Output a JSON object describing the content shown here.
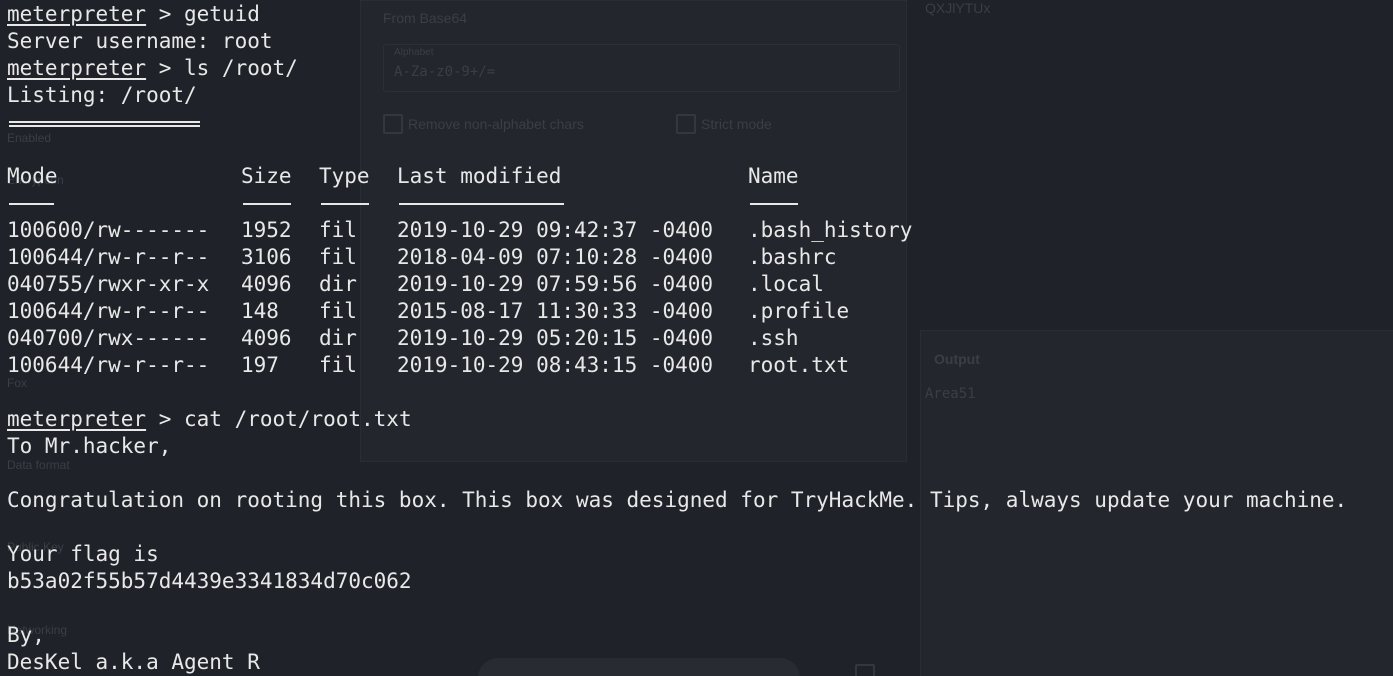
{
  "ghost": {
    "from_base64": "From Base64",
    "alphabet_label": "Alphabet",
    "alphabet_value": "A-Za-z0-9+/=",
    "remove_nonalpha": "Remove non-alphabet chars",
    "strict_mode": "Strict mode",
    "output_label": "Output",
    "output_value": "Area51",
    "top_right": "QXJlYTUx",
    "side1": "Enabled",
    "side2": "Encryption",
    "side3": "Data format",
    "side4": "Public Key",
    "side5": "Networking",
    "side6": "Fox"
  },
  "terminal": {
    "prompt": "meterpreter",
    "cmd1": " > getuid",
    "out1": "Server username: root",
    "cmd2": " > ls /root/",
    "out2": "Listing: /root/",
    "headers": {
      "mode": "Mode",
      "size": "Size",
      "type": "Type",
      "modified": "Last modified",
      "name": "Name"
    },
    "rows": [
      {
        "mode": "100600/rw-------",
        "size": "1952",
        "type": "fil",
        "modified": "2019-10-29 09:42:37 -0400",
        "name": ".bash_history"
      },
      {
        "mode": "100644/rw-r--r--",
        "size": "3106",
        "type": "fil",
        "modified": "2018-04-09 07:10:28 -0400",
        "name": ".bashrc"
      },
      {
        "mode": "040755/rwxr-xr-x",
        "size": "4096",
        "type": "dir",
        "modified": "2019-10-29 07:59:56 -0400",
        "name": ".local"
      },
      {
        "mode": "100644/rw-r--r--",
        "size": "148",
        "type": "fil",
        "modified": "2015-08-17 11:30:33 -0400",
        "name": ".profile"
      },
      {
        "mode": "040700/rwx------",
        "size": "4096",
        "type": "dir",
        "modified": "2019-10-29 05:20:15 -0400",
        "name": ".ssh"
      },
      {
        "mode": "100644/rw-r--r--",
        "size": "197",
        "type": "fil",
        "modified": "2019-10-29 08:43:15 -0400",
        "name": "root.txt"
      }
    ],
    "cmd3": " > cat /root/root.txt",
    "out3": "To Mr.hacker,",
    "out4": "Congratulation on rooting this box. This box was designed for TryHackMe. Tips, always update your machine.",
    "out5": "Your flag is",
    "flag": "b53a02f55b57d4439e3341834d70c062",
    "out6": "By,",
    "out7": "DesKel a.k.a Agent R"
  }
}
